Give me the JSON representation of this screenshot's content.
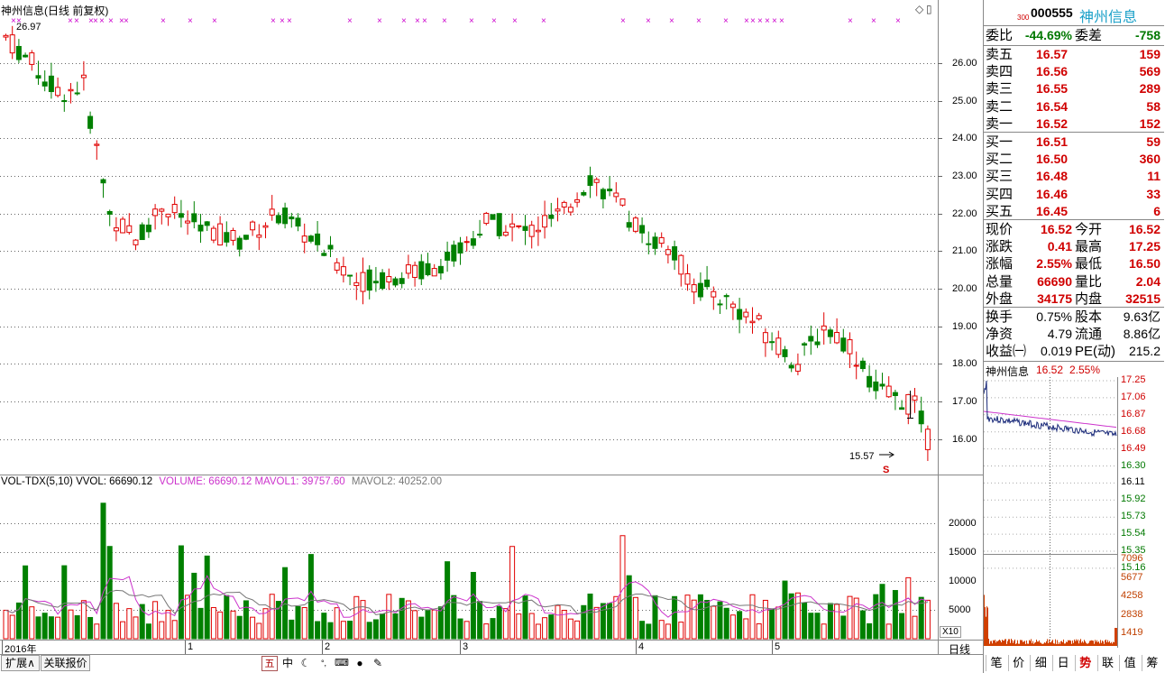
{
  "main_chart": {
    "title": "神州信息(日线 前复权)",
    "high_label": "26.97",
    "low_label": "15.57",
    "current_marker": "S",
    "y_ticks": [
      "26.00",
      "25.00",
      "24.00",
      "23.00",
      "22.00",
      "21.00",
      "20.00",
      "19.00",
      "18.00",
      "17.00",
      "16.00"
    ],
    "price_range": [
      15.2,
      27.2
    ]
  },
  "volume_chart": {
    "header_prefix": "VOL-TDX(5,10)",
    "vvol": "VVOL: 66690.12",
    "volume": "VOLUME: 66690.12",
    "mavol1": "MAVOL1: 39757.60",
    "mavol2": "MAVOL2: 40252.00",
    "y_ticks": [
      "20000",
      "15000",
      "10000",
      "5000"
    ],
    "unit": "X10",
    "max": 25500
  },
  "x_axis": {
    "labels": [
      "2016年",
      "1",
      "2",
      "3",
      "4",
      "5"
    ],
    "period": "日线"
  },
  "colors": {
    "up": "#e00000",
    "down": "#008000",
    "ma1": "#cc33cc",
    "ma2": "#777777"
  },
  "bottom_bar": {
    "left_buttons": [
      "扩展∧",
      "关联报价"
    ],
    "toolbar_icons": [
      "五",
      "中",
      "moon-icon",
      "dots-icon",
      "keyboard-icon",
      "user-icon",
      "wrench-icon"
    ]
  },
  "quote": {
    "code_prefix": "300",
    "code": "000555",
    "name": "神州信息",
    "weibi_label": "委比",
    "weibi": "-44.69%",
    "weicha_label": "委差",
    "weicha": "-758",
    "asks": [
      {
        "label": "卖五",
        "price": "16.57",
        "vol": "159"
      },
      {
        "label": "卖四",
        "price": "16.56",
        "vol": "569"
      },
      {
        "label": "卖三",
        "price": "16.55",
        "vol": "289"
      },
      {
        "label": "卖二",
        "price": "16.54",
        "vol": "58"
      },
      {
        "label": "卖一",
        "price": "16.52",
        "vol": "152"
      }
    ],
    "bids": [
      {
        "label": "买一",
        "price": "16.51",
        "vol": "59"
      },
      {
        "label": "买二",
        "price": "16.50",
        "vol": "360"
      },
      {
        "label": "买三",
        "price": "16.48",
        "vol": "11"
      },
      {
        "label": "买四",
        "price": "16.46",
        "vol": "33"
      },
      {
        "label": "买五",
        "price": "16.45",
        "vol": "6"
      }
    ],
    "stats": [
      {
        "l1": "现价",
        "v1": "16.52",
        "l2": "今开",
        "v2": "16.52"
      },
      {
        "l1": "涨跌",
        "v1": "0.41",
        "l2": "最高",
        "v2": "17.25"
      },
      {
        "l1": "涨幅",
        "v1": "2.55%",
        "l2": "最低",
        "v2": "16.50"
      },
      {
        "l1": "总量",
        "v1": "66690",
        "l2": "量比",
        "v2": "2.04"
      },
      {
        "l1": "外盘",
        "v1": "34175",
        "l2": "内盘",
        "v2": "32515"
      }
    ],
    "fundamentals": [
      {
        "l1": "换手",
        "v1": "0.75%",
        "l2": "股本",
        "v2": "9.63亿"
      },
      {
        "l1": "净资",
        "v1": "4.79",
        "l2": "流通",
        "v2": "8.86亿"
      },
      {
        "l1": "收益㈠",
        "v1": "0.019",
        "l2": "PE(动)",
        "v2": "215.2"
      }
    ]
  },
  "mini_chart": {
    "title": "神州信息",
    "price": "16.52",
    "pct": "2.55%",
    "price_ticks": [
      "17.25",
      "17.06",
      "16.87",
      "16.68",
      "16.49",
      "16.30",
      "16.11",
      "15.92",
      "15.73",
      "15.54",
      "15.35",
      "15.16"
    ],
    "vol_ticks": [
      "7096",
      "5677",
      "4258",
      "2838",
      "1419"
    ]
  },
  "right_tabs": [
    "笔",
    "价",
    "细",
    "日",
    "势",
    "联",
    "值",
    "筹"
  ],
  "active_tab": "势"
}
